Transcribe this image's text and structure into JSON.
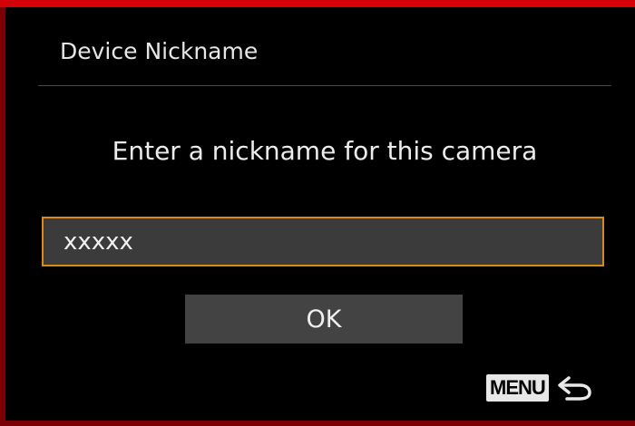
{
  "colors": {
    "accent_red": "#d4000a",
    "field_border": "#d98a19",
    "background": "#000000"
  },
  "dialog": {
    "title": "Device Nickname",
    "prompt": "Enter a nickname for this camera",
    "nickname_value": "xxxxx",
    "ok_label": "OK"
  },
  "footer": {
    "menu_label": "MENU",
    "back_icon": "return-arrow-icon"
  }
}
